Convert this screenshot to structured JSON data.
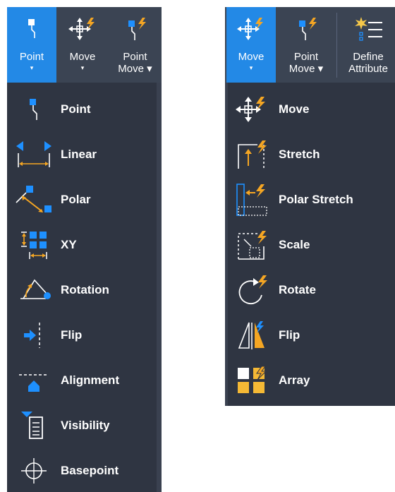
{
  "left_panel": {
    "toolbar": [
      {
        "label": "Point",
        "caret": "▾",
        "icon": "point-parameter-icon",
        "active": true
      },
      {
        "label": "Move",
        "caret": "▾",
        "icon": "move-action-icon",
        "active": false
      },
      {
        "label": "Point",
        "label2": "Move ▾",
        "icon": "point-move-icon",
        "active": false
      }
    ],
    "menu": [
      {
        "label": "Point",
        "icon": "point-parameter-icon"
      },
      {
        "label": "Linear",
        "icon": "linear-parameter-icon"
      },
      {
        "label": "Polar",
        "icon": "polar-parameter-icon"
      },
      {
        "label": "XY",
        "icon": "xy-parameter-icon"
      },
      {
        "label": "Rotation",
        "icon": "rotation-parameter-icon"
      },
      {
        "label": "Flip",
        "icon": "flip-parameter-icon"
      },
      {
        "label": "Alignment",
        "icon": "alignment-parameter-icon"
      },
      {
        "label": "Visibility",
        "icon": "visibility-parameter-icon"
      },
      {
        "label": "Basepoint",
        "icon": "basepoint-parameter-icon"
      }
    ]
  },
  "right_panel": {
    "toolbar": [
      {
        "label": "Move",
        "caret": "▾",
        "icon": "move-action-icon",
        "active": true
      },
      {
        "label": "Point",
        "label2": "Move ▾",
        "icon": "point-move-icon",
        "active": false
      },
      {
        "label": "Define",
        "label2": "Attribute",
        "icon": "define-attribute-icon",
        "active": false
      }
    ],
    "menu": [
      {
        "label": "Move",
        "icon": "move-action-icon"
      },
      {
        "label": "Stretch",
        "icon": "stretch-action-icon"
      },
      {
        "label": "Polar Stretch",
        "icon": "polar-stretch-action-icon"
      },
      {
        "label": "Scale",
        "icon": "scale-action-icon"
      },
      {
        "label": "Rotate",
        "icon": "rotate-action-icon"
      },
      {
        "label": "Flip",
        "icon": "flip-action-icon"
      },
      {
        "label": "Array",
        "icon": "array-action-icon"
      }
    ]
  },
  "colors": {
    "accent_blue": "#2389e6",
    "icon_blue": "#1e90ff",
    "lightning_orange": "#f5a623",
    "toolbar_bg": "#3b4453",
    "menu_bg": "#2f3542",
    "text": "#ffffff"
  }
}
